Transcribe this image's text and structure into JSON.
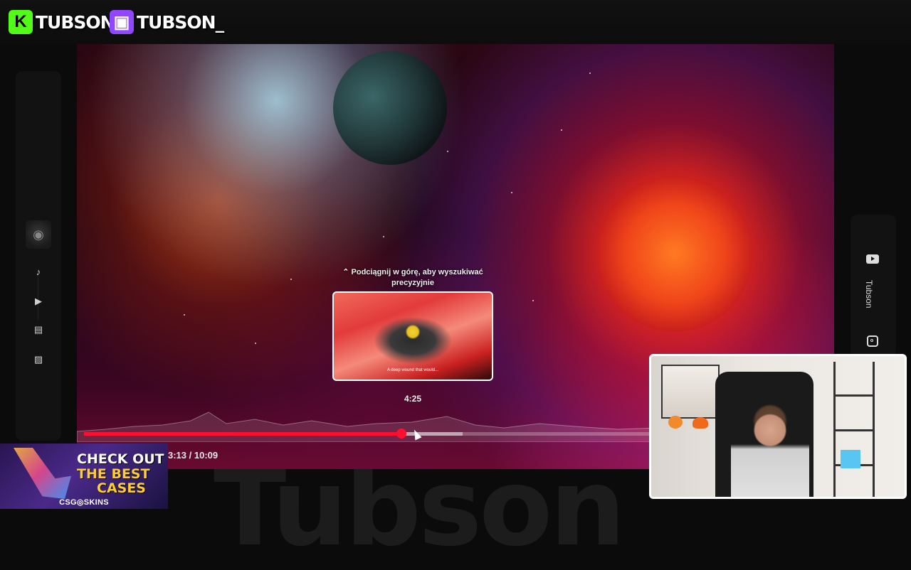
{
  "branding": {
    "kick": {
      "logo_letter": "K",
      "name": "TUBSON",
      "color": "#53fc18"
    },
    "twitch": {
      "logo_letter": "▣",
      "name": "TUBSON_",
      "color": "#9146ff"
    }
  },
  "background_word": "Tubson",
  "sidebar": {
    "items": [
      {
        "icon": "music-note-icon",
        "glyph": "♪"
      },
      {
        "icon": "video-play-icon",
        "glyph": "▶"
      },
      {
        "icon": "clapperboard-icon",
        "glyph": "▤"
      },
      {
        "icon": "image-icon",
        "glyph": "▨"
      }
    ]
  },
  "socials": {
    "channel_name": "Tubson",
    "icons": [
      "youtube-icon",
      "instagram-icon"
    ]
  },
  "player": {
    "seek_hint": "⌃ Podciągnij w górę, aby wyszukiwać precyzyjnie",
    "preview_caption": "A deep wound that would...",
    "preview_time": "4:25",
    "time_display": "3:13 / 10:09",
    "progress_fraction": 0.427,
    "buffer_fraction": 0.51,
    "accent_color": "#ff0f2f"
  },
  "sponsor": {
    "line1": "CHECK OUT",
    "line2": "THE BEST",
    "line3": "CASES",
    "brand": "CSG◎SKINS",
    "highlight_color": "#ffcd2e"
  }
}
